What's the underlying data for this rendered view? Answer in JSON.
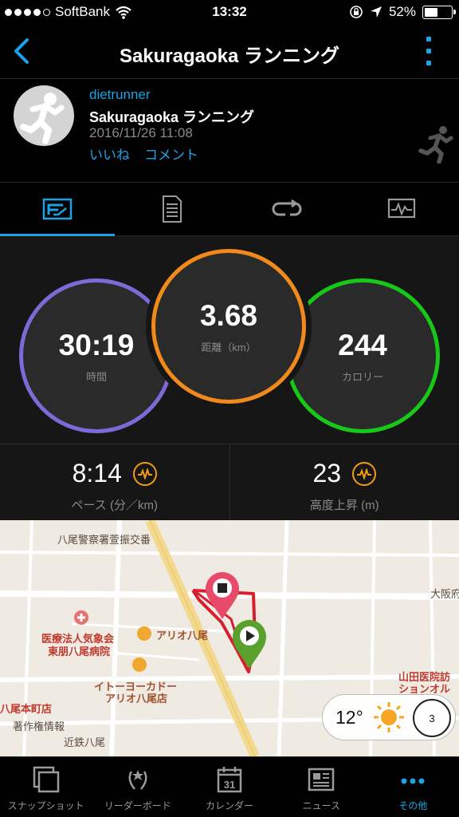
{
  "status_bar": {
    "carrier": "SoftBank",
    "time": "13:32",
    "battery": "52%",
    "battery_level": 0.52
  },
  "header": {
    "title": "Sakuragaoka ランニング"
  },
  "activity": {
    "user": "dietrunner",
    "name": "Sakuragaoka ランニング",
    "date": "2016/11/26 11:08",
    "like_label": "いいね",
    "comment_label": "コメント"
  },
  "tabs": [
    {
      "icon": "overview-icon",
      "active": true
    },
    {
      "icon": "details-icon",
      "active": false
    },
    {
      "icon": "laps-icon",
      "active": false
    },
    {
      "icon": "chart-icon",
      "active": false
    }
  ],
  "stats": {
    "time": {
      "value": "30:19",
      "label": "時間",
      "color": "#7b6bd6"
    },
    "distance": {
      "value": "3.68",
      "label": "距離（km）",
      "color": "#f08a1c"
    },
    "calories": {
      "value": "244",
      "label": "カロリー",
      "color": "#18c818"
    },
    "pace": {
      "value": "8:14",
      "label": "ペース (分／km)"
    },
    "elevation": {
      "value": "23",
      "label": "高度上昇 (m)"
    }
  },
  "map": {
    "labels": {
      "police": "八尾警察署萱振交番",
      "osaka": "大阪府",
      "hospital_1": "医療法人気象会",
      "hospital_2": "東朋八尾病院",
      "ario": "アリオ八尾",
      "itoyokado_1": "イトーヨーカドー",
      "itoyokado_2": "アリオ八尾店",
      "yamada_1": "山田医院訪",
      "yamada_2": "ションオル",
      "yaomoto": "八尾本町店",
      "chosaku": "著作権情報",
      "kintetsu": "近鉄八尾"
    },
    "weather": {
      "temp": "12°",
      "wind": "3"
    }
  },
  "bottom_nav": [
    {
      "label": "スナップショット",
      "icon": "snapshot-icon",
      "active": false
    },
    {
      "label": "リーダーボード",
      "icon": "leaderboard-icon",
      "active": false
    },
    {
      "label": "カレンダー",
      "icon": "calendar-icon",
      "calendar_day": "31",
      "active": false
    },
    {
      "label": "ニュース",
      "icon": "news-icon",
      "active": false
    },
    {
      "label": "その他",
      "icon": "more-icon",
      "active": true
    }
  ],
  "colors": {
    "accent": "#1aa3e8",
    "pace_icon": "#f39c12",
    "route": "#d6202f"
  }
}
